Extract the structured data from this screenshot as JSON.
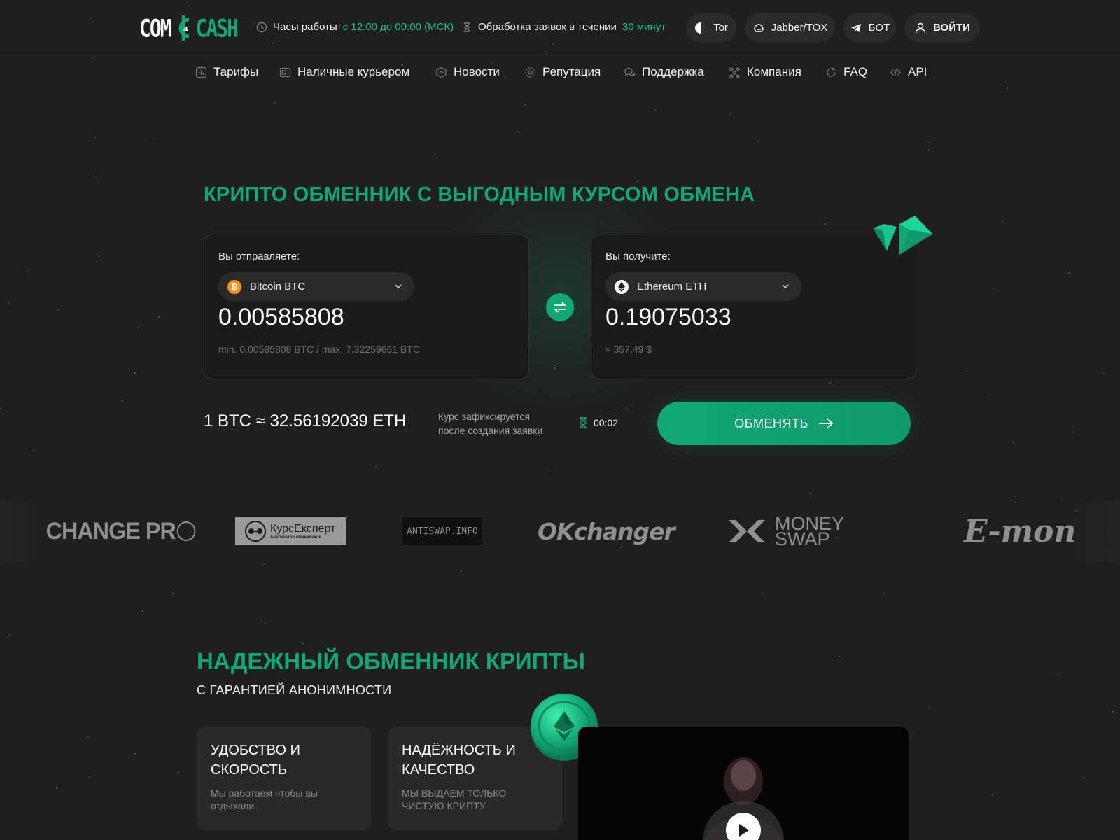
{
  "header": {
    "logo_left": "COM",
    "logo_right": "CASH",
    "hours_label": "Часы работы",
    "hours_value": "с 12:00 до 00:00 (МСК)",
    "processing_label": "Обработка заявок в течении",
    "processing_value": "30 минут",
    "buttons": {
      "tor": "Tor",
      "jabber": "Jabber/TOX",
      "bot": "БОТ",
      "login": "ВОЙТИ"
    }
  },
  "nav": [
    {
      "label": "Тарифы",
      "icon": "chart-icon"
    },
    {
      "label": "Наличные курьером",
      "icon": "wallet-icon"
    },
    {
      "label": "Новости",
      "icon": "news-icon"
    },
    {
      "label": "Репутация",
      "icon": "reputation-icon"
    },
    {
      "label": "Поддержка",
      "icon": "chat-icon"
    },
    {
      "label": "Компания",
      "icon": "company-icon"
    },
    {
      "label": "FAQ",
      "icon": "faq-icon"
    },
    {
      "label": "API",
      "icon": "code-icon"
    }
  ],
  "hero": {
    "title": "КРИПТО ОБМЕННИК С ВЫГОДНЫМ КУРСОМ ОБМЕНА",
    "send": {
      "label": "Вы отправляете:",
      "currency": "Bitcoin BTC",
      "amount": "0.00585808",
      "limits": "min. 0.00585808 BTC / max. 7.32259661 BTC"
    },
    "receive": {
      "label": "Вы получите:",
      "currency": "Ethereum ETH",
      "amount": "0.19075033",
      "usd": "≈ 357.49 $"
    },
    "rate": "1 BTC ≈ 32.56192039 ETH",
    "rate_note_1": "Курс зафиксируется",
    "rate_note_2": "после создания заявки",
    "timer": "00:02",
    "exchange_button": "ОБМЕНЯТЬ"
  },
  "partners": {
    "p1": "CHANGE PR",
    "p2": "КурсЕксперт",
    "p2_sub": "Анализатор обменников",
    "p3": "ANTISWAP.INFO",
    "p4": "OKchanger",
    "p5_line1": "MONEY",
    "p5_line2": "SWAP",
    "p6": "E-mon"
  },
  "section2": {
    "title": "НАДЕЖНЫЙ ОБМЕННИК КРИПТЫ",
    "subtitle": "С ГАРАНТИЕЙ АНОНИМНОСТИ",
    "cards": [
      {
        "title": "УДОБСТВО И СКОРОСТЬ",
        "text": "Мы работаем чтобы вы отдыхали"
      },
      {
        "title": "НАДЁЖНОСТЬ И КАЧЕСТВО",
        "text": "МЫ ВЫДАЕМ ТОЛЬКО ЧИСТУЮ КРИПТУ"
      }
    ]
  },
  "colors": {
    "accent": "#12a876",
    "background": "#1f1f1f",
    "card": "#1b1b1b",
    "pill": "#2a2a2a"
  }
}
